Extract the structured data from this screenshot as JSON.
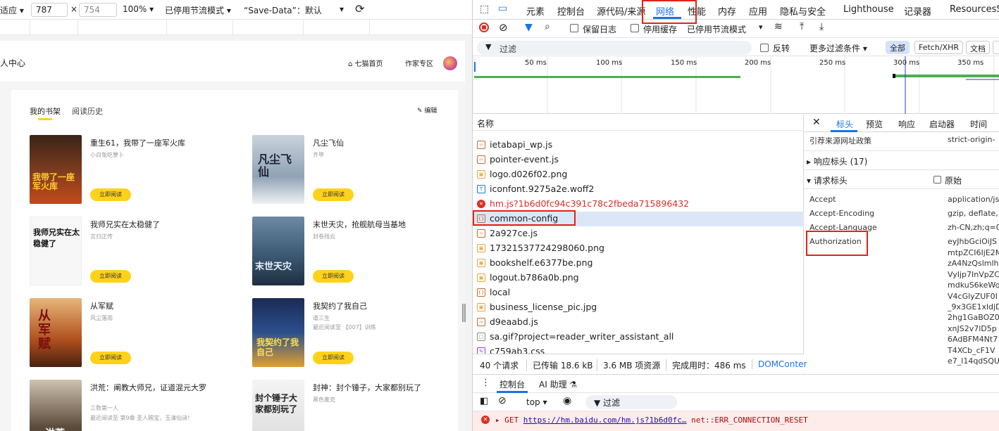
{
  "device_toolbar": {
    "preset": "适应",
    "width": "787",
    "x": "×",
    "height": "754",
    "zoom": "100%",
    "throttle": "已停用节流模式",
    "save_data": "“Save-Data”：默认"
  },
  "site": {
    "header_title": "人中心",
    "nav_home": "七猫首页",
    "nav_author": "作家专区",
    "tabs": [
      "我的书架",
      "阅读历史"
    ],
    "edit": "编辑",
    "read_btn": "立即阅读",
    "books": [
      {
        "title": "重生61，我带了一座军火库",
        "author": "小白兔吃萝卜",
        "cover_text": "我带了一座军火库",
        "color": "#7a3b1e"
      },
      {
        "title": "凡尘飞仙",
        "author": "齐甲",
        "cover_text": "凡尘飞仙",
        "color": "#8fa3b5"
      },
      {
        "title": "我师兄实在太稳健了",
        "author": "言归正传",
        "cover_text": "我师兄实在太稳健了",
        "color": "#f4f4f4"
      },
      {
        "title": "末世天灾，抢舰航母当基地",
        "author": "封卷残云",
        "cover_text": "末世天灾",
        "color": "#3d5a75"
      },
      {
        "title": "从军赋",
        "author": "风尘落雨",
        "cover_text": "从军赋",
        "color": "#b0511e"
      },
      {
        "title": "我契约了我自己",
        "author": "道三生",
        "author_extra": "最近阅读至 【007】训练",
        "cover_text": "我契约了我自己",
        "color": "#2b4f8c"
      },
      {
        "title": "洪荒：阐教大师兄，证道混元大罗",
        "author": "三数第一人",
        "author_extra": "最近阅读至 第9章 圣人赐宝，玉清仙诀!",
        "cover_text": "洪荒",
        "color": "#5a4a3a"
      },
      {
        "title": "封神：封个锤子，大家都别玩了",
        "author": "黑色麦克",
        "cover_text": "封个锤子大家都别玩了",
        "color": "#dcdcdc"
      }
    ]
  },
  "devtools": {
    "tabs": [
      "元素",
      "控制台",
      "源代码/来源",
      "网络",
      "性能",
      "内存",
      "应用",
      "隐私与安全",
      "Lighthouse",
      "记录器",
      "ResourcesSa"
    ],
    "toolbar": {
      "preserve_log": "保留日志",
      "disable_cache": "停用缓存",
      "throttle": "已停用节流模式"
    },
    "filter": {
      "placeholder": "过滤",
      "invert": "反转",
      "more": "更多过滤条件",
      "all": "全部",
      "fetch": "Fetch/XHR",
      "doc": "文档"
    },
    "timeline_labels": [
      "50 ms",
      "100 ms",
      "150 ms",
      "200 ms",
      "250 ms",
      "300 ms",
      "350 ms"
    ],
    "list_header": "名称",
    "requests": [
      {
        "name": "ietabapi_wp.js",
        "type": "js"
      },
      {
        "name": "pointer-event.js",
        "type": "js"
      },
      {
        "name": "logo.d026f02.png",
        "type": "img"
      },
      {
        "name": "iconfont.9275a2e.woff2",
        "type": "font"
      },
      {
        "name": "hm.js?1b6d0fc94c391c78c2fbeda715896432",
        "type": "error"
      },
      {
        "name": "common-config",
        "type": "xhr"
      },
      {
        "name": "2a927ce.js",
        "type": "js"
      },
      {
        "name": "17321537724298060.png",
        "type": "img"
      },
      {
        "name": "bookshelf.e6377be.png",
        "type": "img"
      },
      {
        "name": "logout.b786a0b.png",
        "type": "img"
      },
      {
        "name": "local",
        "type": "xhr"
      },
      {
        "name": "business_license_pic.jpg",
        "type": "img"
      },
      {
        "name": "d9eaabd.js",
        "type": "js"
      },
      {
        "name": "sa.gif?project=reader_writer_assistant_all",
        "type": "other"
      },
      {
        "name": "c759ab3.css",
        "type": "css"
      }
    ],
    "status": {
      "requests": "40 个请求",
      "transferred": "已传输 18.6 kB",
      "resources": "3.6 MB 项资源",
      "finish": "完成用时：486 ms",
      "dom": "DOMConter"
    },
    "detail_tabs": [
      "标头",
      "预览",
      "响应",
      "启动器",
      "时间"
    ],
    "referrer_key": "引荐来源网址政策",
    "referrer_val": "strict-origin-",
    "response_headers": "响应标头 (17)",
    "request_headers": "请求标头",
    "raw": "原始",
    "headers": [
      {
        "k": "Accept",
        "v": "application/js"
      },
      {
        "k": "Accept-Encoding",
        "v": "gzip, deflate,"
      },
      {
        "k": "Accept-Language",
        "v": "zh-CN,zh;q=0"
      },
      {
        "k": "Authorization",
        "v": "eyJhbGciOiJS"
      }
    ],
    "auth_lines": [
      "mtpZCI6IjE2M",
      "zA4NzQslmlh",
      "VyIjp7InVpZC",
      "mdkuS6keWo",
      "V4cGlyZUF0I",
      "_9x3GE1xldjD",
      "2hg1GaBOZ0",
      "xnJS2v7lD5p",
      "6AdBFM4Nt7",
      "T4XCb_cF1V",
      "e7_l14qdSQU"
    ],
    "drawer_tabs": [
      "控制台",
      "AI 助理"
    ],
    "console_context": "top",
    "console_filter": "过滤",
    "console_msg": {
      "method": "GET",
      "url": "https://hm.baidu.com/hm.js?1b6d0fc…",
      "error": "net::ERR_CONNECTION_RESET"
    }
  }
}
